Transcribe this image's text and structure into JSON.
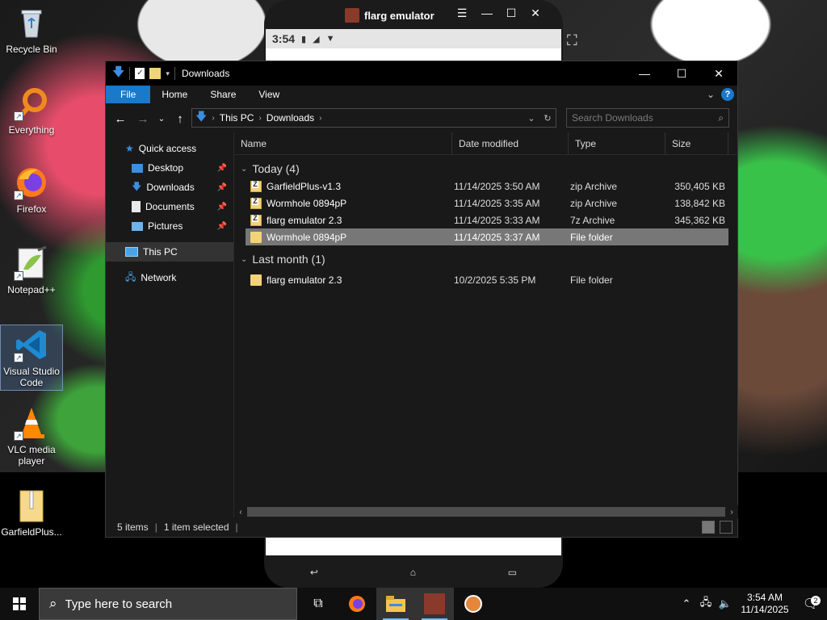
{
  "desktop": {
    "icons": [
      {
        "label": "Recycle Bin"
      },
      {
        "label": "Everything"
      },
      {
        "label": "Firefox"
      },
      {
        "label": "Notepad++"
      },
      {
        "label": "Visual Studio Code"
      },
      {
        "label": "VLC media player"
      },
      {
        "label": "GarfieldPlus..."
      }
    ]
  },
  "emulator": {
    "title": "flarg emulator",
    "status_time": "3:54"
  },
  "explorer": {
    "title": "Downloads",
    "ribbon": {
      "file": "File",
      "home": "Home",
      "share": "Share",
      "view": "View"
    },
    "address": {
      "crumb1": "This PC",
      "crumb2": "Downloads"
    },
    "search": {
      "placeholder": "Search Downloads"
    },
    "nav": {
      "quick_access": "Quick access",
      "desktop": "Desktop",
      "downloads": "Downloads",
      "documents": "Documents",
      "pictures": "Pictures",
      "this_pc": "This PC",
      "network": "Network"
    },
    "columns": {
      "name": "Name",
      "date": "Date modified",
      "type": "Type",
      "size": "Size"
    },
    "groups": [
      {
        "label": "Today (4)",
        "rows": [
          {
            "name": "GarfieldPlus-v1.3",
            "date": "11/14/2025 3:50 AM",
            "type": "zip Archive",
            "size": "350,405 KB",
            "icon": "zip"
          },
          {
            "name": "Wormhole 0894pP",
            "date": "11/14/2025 3:35 AM",
            "type": "zip Archive",
            "size": "138,842 KB",
            "icon": "zip"
          },
          {
            "name": "flarg emulator 2.3",
            "date": "11/14/2025 3:33 AM",
            "type": "7z Archive",
            "size": "345,362 KB",
            "icon": "zip"
          },
          {
            "name": "Wormhole 0894pP",
            "date": "11/14/2025 3:37 AM",
            "type": "File folder",
            "size": "",
            "icon": "folder"
          }
        ]
      },
      {
        "label": "Last month (1)",
        "rows": [
          {
            "name": "flarg emulator 2.3",
            "date": "10/2/2025 5:35 PM",
            "type": "File folder",
            "size": "",
            "icon": "folder"
          }
        ]
      }
    ],
    "status": {
      "items": "5 items",
      "selected": "1 item selected"
    }
  },
  "taskbar": {
    "search_placeholder": "Type here to search",
    "time": "3:54 AM",
    "date": "11/14/2025",
    "notification_count": "2"
  },
  "colors": {
    "accent": "#1979ca",
    "window_bg": "#191919",
    "selection": "#777777"
  }
}
